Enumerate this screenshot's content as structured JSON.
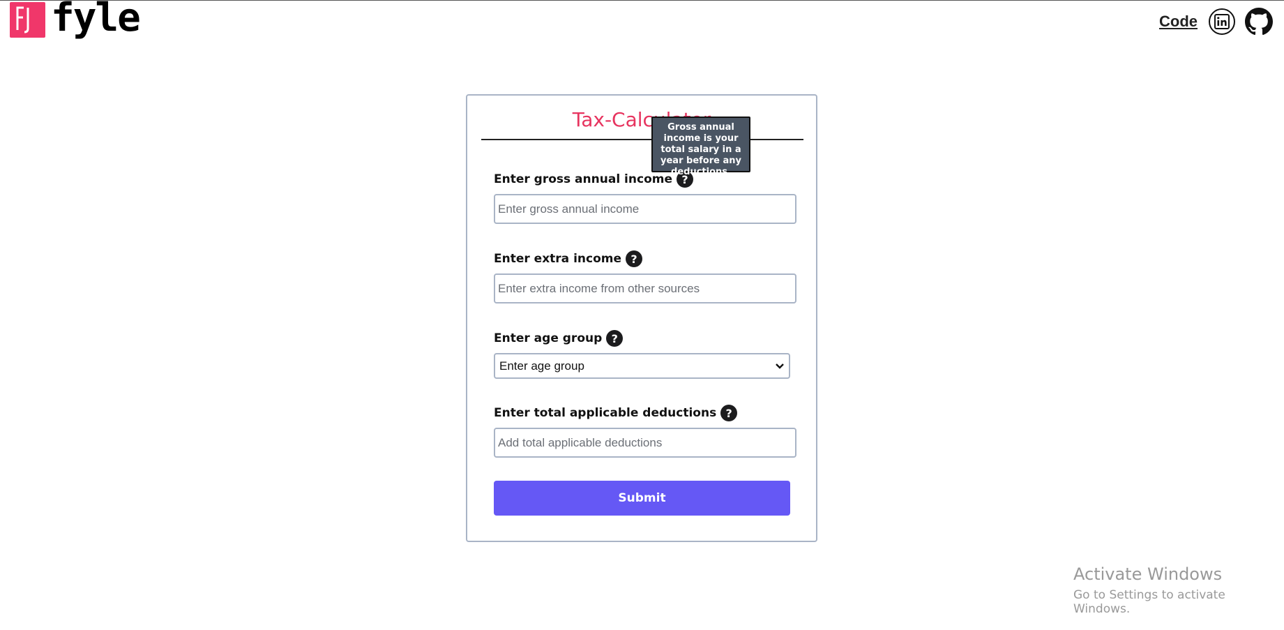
{
  "header": {
    "logo_text": "fyle",
    "nav_code_label": "Code",
    "linkedin_icon": "linkedin-icon",
    "github_icon": "github-icon"
  },
  "form": {
    "title": "Tax-Calculator",
    "tooltip": "Gross annual income is your total salary in a year before any deductions.",
    "gross_label": "Enter gross annual income",
    "gross_placeholder": "Enter gross annual income",
    "extra_label": "Enter extra income",
    "extra_placeholder": "Enter extra income from other sources",
    "age_label": "Enter age group",
    "age_selected": "Enter age group",
    "deductions_label": "Enter total applicable deductions",
    "deductions_placeholder": "Add total applicable deductions",
    "help_glyph": "?",
    "submit_label": "Submit"
  },
  "watermark": {
    "title": "Activate Windows",
    "subtitle": "Go to Settings to activate Windows."
  },
  "colors": {
    "brand": "#f0376a",
    "title": "#e7345f",
    "submit": "#6558f5",
    "tooltip_bg": "#4a5563"
  }
}
